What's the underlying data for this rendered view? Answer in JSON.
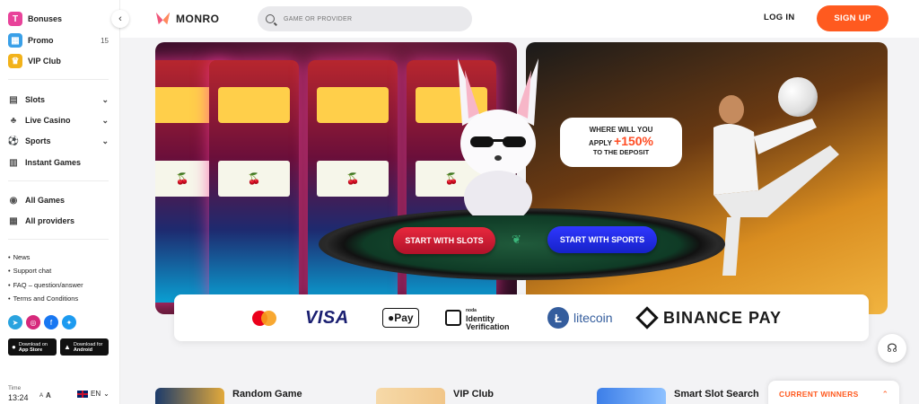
{
  "sidebar": {
    "top_items": [
      {
        "label": "Bonuses",
        "icon": "bonus-icon",
        "color": "#e8439a"
      },
      {
        "label": "Promo",
        "icon": "promo-icon",
        "color": "#3aa0e8",
        "count": "15"
      },
      {
        "label": "VIP Club",
        "icon": "crown-icon",
        "color": "#f2b21a"
      }
    ],
    "nav_items": [
      {
        "label": "Slots",
        "icon": "slots-icon"
      },
      {
        "label": "Live Casino",
        "icon": "live-casino-icon"
      },
      {
        "label": "Sports",
        "icon": "sports-icon"
      },
      {
        "label": "Instant Games",
        "icon": "instant-games-icon"
      }
    ],
    "game_items": [
      {
        "label": "All Games",
        "icon": "all-games-icon"
      },
      {
        "label": "All providers",
        "icon": "providers-icon"
      }
    ],
    "links": [
      "News",
      "Support chat",
      "FAQ – question/answer",
      "Terms and Conditions"
    ],
    "social": [
      {
        "name": "telegram-icon",
        "color": "#2aa3df"
      },
      {
        "name": "instagram-icon",
        "color": "#d6297b"
      },
      {
        "name": "facebook-icon",
        "color": "#1877f2"
      },
      {
        "name": "twitter-icon",
        "color": "#1d9bf0"
      }
    ],
    "stores": [
      {
        "top": "Download on",
        "name": "App Store"
      },
      {
        "top": "Download for",
        "name": "Android"
      }
    ],
    "time_label": "Time",
    "time_value": "13:24",
    "font_small": "A",
    "font_large": "A",
    "language": "EN"
  },
  "header": {
    "logo_text": "MONRO",
    "search_placeholder": "GAME OR PROVIDER",
    "login_label": "LOG IN",
    "signup_label": "SIGN UP",
    "accent": "#ff5a1f"
  },
  "banner": {
    "bubble_line1": "WHERE WILL YOU",
    "bubble_line2": "APPLY",
    "bubble_percent": "+150%",
    "bubble_line3": "TO THE DEPOSIT",
    "slot_fruit": "🍒",
    "slots_button": "START WITH SLOTS",
    "sports_button": "START WITH SPORTS"
  },
  "payments": {
    "visa": "VISA",
    "applepay": "Pay",
    "noda_small": "noda",
    "noda_line1": "Identity",
    "noda_line2": "Verification",
    "litecoin": "litecoin",
    "binance": "BINANCE PAY"
  },
  "promos": [
    {
      "label": "Random Game"
    },
    {
      "label": "VIP Club"
    },
    {
      "label": "Smart Slot Search"
    }
  ],
  "winners": {
    "label": "CURRENT WINNERS"
  }
}
